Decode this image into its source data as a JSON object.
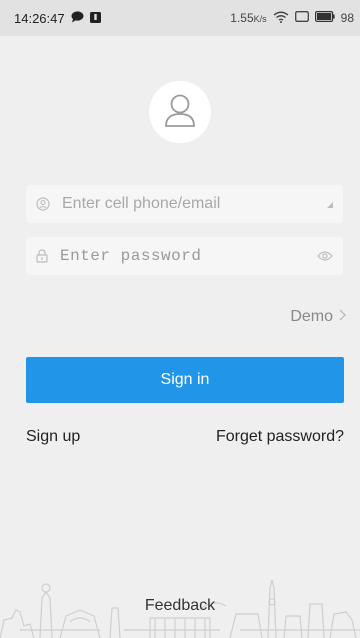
{
  "status_bar": {
    "time": "14:26:47",
    "network_speed": "1.55",
    "network_unit": "K/s",
    "battery": "98",
    "icons": [
      "chat-bubble-icon",
      "notification-icon",
      "wifi-icon",
      "sim-icon",
      "battery-icon"
    ]
  },
  "login": {
    "avatar_icon": "user-icon",
    "username": {
      "placeholder": "Enter cell phone/email",
      "value": "",
      "icon": "user-circle-icon"
    },
    "password": {
      "placeholder": "Enter password",
      "value": "",
      "icon": "lock-icon",
      "toggle_icon": "eye-icon"
    },
    "demo_label": "Demo",
    "signin_label": "Sign in",
    "signup_label": "Sign up",
    "forget_label": "Forget password?",
    "feedback_label": "Feedback"
  },
  "colors": {
    "accent": "#2196e8",
    "background": "#efefef",
    "field": "#f6f6f6"
  }
}
